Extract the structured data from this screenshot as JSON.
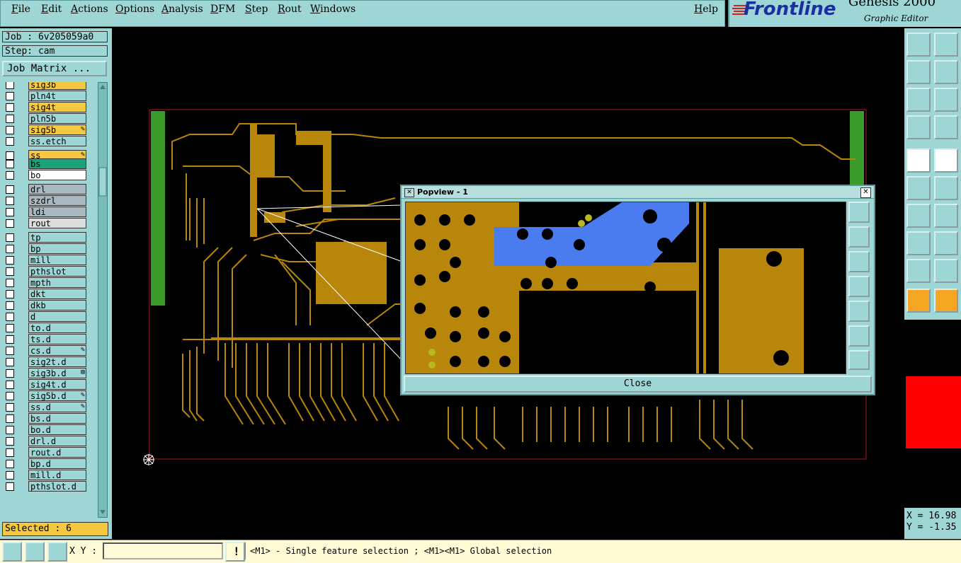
{
  "menu": {
    "items": [
      "File",
      "Edit",
      "Actions",
      "Options",
      "Analysis",
      "DFM",
      "Step",
      "Rout",
      "Windows"
    ],
    "help": "Help"
  },
  "brand": {
    "logo": "Frontline",
    "title": "Genesis 2000",
    "subtitle": "Graphic Editor"
  },
  "job": {
    "job_label": "Job : 6v205059a0",
    "step_label": "Step: cam",
    "matrix_button": "Job Matrix ..."
  },
  "layers": [
    {
      "name": "sig3b",
      "color": "#f5c842",
      "mark": ""
    },
    {
      "name": "pln4t",
      "color": "#9ed6d6",
      "mark": ""
    },
    {
      "name": "sig4t",
      "color": "#f5c842",
      "mark": ""
    },
    {
      "name": "pln5b",
      "color": "#9ed6d6",
      "mark": ""
    },
    {
      "name": "sig5b",
      "color": "#f5c842",
      "mark": "✎"
    },
    {
      "name": "ss.etch",
      "color": "#9ed6d6",
      "mark": ""
    },
    {
      "name": "ss",
      "color": "#f5c842",
      "mark": "✎"
    },
    {
      "name": "bs",
      "color": "#1aa37a",
      "mark": ""
    },
    {
      "name": "bo",
      "color": "#ffffff",
      "mark": ""
    },
    {
      "name": "drl",
      "color": "#a8b8c0",
      "mark": ""
    },
    {
      "name": "szdrl",
      "color": "#a8b8c0",
      "mark": ""
    },
    {
      "name": "ldi",
      "color": "#a8b8c0",
      "mark": ""
    },
    {
      "name": "rout",
      "color": "#dcdcdc",
      "mark": ""
    },
    {
      "name": "tp",
      "color": "#9ed6d6",
      "mark": ""
    },
    {
      "name": "bp",
      "color": "#9ed6d6",
      "mark": ""
    },
    {
      "name": "mill",
      "color": "#9ed6d6",
      "mark": ""
    },
    {
      "name": "pthslot",
      "color": "#9ed6d6",
      "mark": ""
    },
    {
      "name": "mpth",
      "color": "#9ed6d6",
      "mark": ""
    },
    {
      "name": "dkt",
      "color": "#9ed6d6",
      "mark": ""
    },
    {
      "name": "dkb",
      "color": "#9ed6d6",
      "mark": ""
    },
    {
      "name": "d",
      "color": "#9ed6d6",
      "mark": ""
    },
    {
      "name": "to.d",
      "color": "#9ed6d6",
      "mark": ""
    },
    {
      "name": "ts.d",
      "color": "#9ed6d6",
      "mark": ""
    },
    {
      "name": "cs.d",
      "color": "#9ed6d6",
      "mark": "✎"
    },
    {
      "name": "sig2t.d",
      "color": "#9ed6d6",
      "mark": ""
    },
    {
      "name": "sig3b.d",
      "color": "#9ed6d6",
      "mark": "⊞"
    },
    {
      "name": "sig4t.d",
      "color": "#9ed6d6",
      "mark": ""
    },
    {
      "name": "sig5b.d",
      "color": "#9ed6d6",
      "mark": "✎"
    },
    {
      "name": "ss.d",
      "color": "#9ed6d6",
      "mark": "✎"
    },
    {
      "name": "bs.d",
      "color": "#9ed6d6",
      "mark": ""
    },
    {
      "name": "bo.d",
      "color": "#9ed6d6",
      "mark": ""
    },
    {
      "name": "drl.d",
      "color": "#9ed6d6",
      "mark": ""
    },
    {
      "name": "rout.d",
      "color": "#9ed6d6",
      "mark": ""
    },
    {
      "name": "bp.d",
      "color": "#9ed6d6",
      "mark": ""
    },
    {
      "name": "mill.d",
      "color": "#9ed6d6",
      "mark": ""
    },
    {
      "name": "pthslot.d",
      "color": "#9ed6d6",
      "mark": ""
    }
  ],
  "selected": "Selected : 6",
  "popup": {
    "title": "Popview - 1",
    "close_button": "Close"
  },
  "coords": {
    "x": "X = 16.98",
    "y": "Y = -1.35"
  },
  "status": {
    "xy_label": "X Y :",
    "xy_value": "",
    "hint": "<M1> - Single feature selection ; <M1><M1> Global selection"
  },
  "colors": {
    "panel": "#9ed6d6",
    "copper": "#b8860b",
    "highlight": "#4a7cf0",
    "active_layer": "#f5c842"
  }
}
